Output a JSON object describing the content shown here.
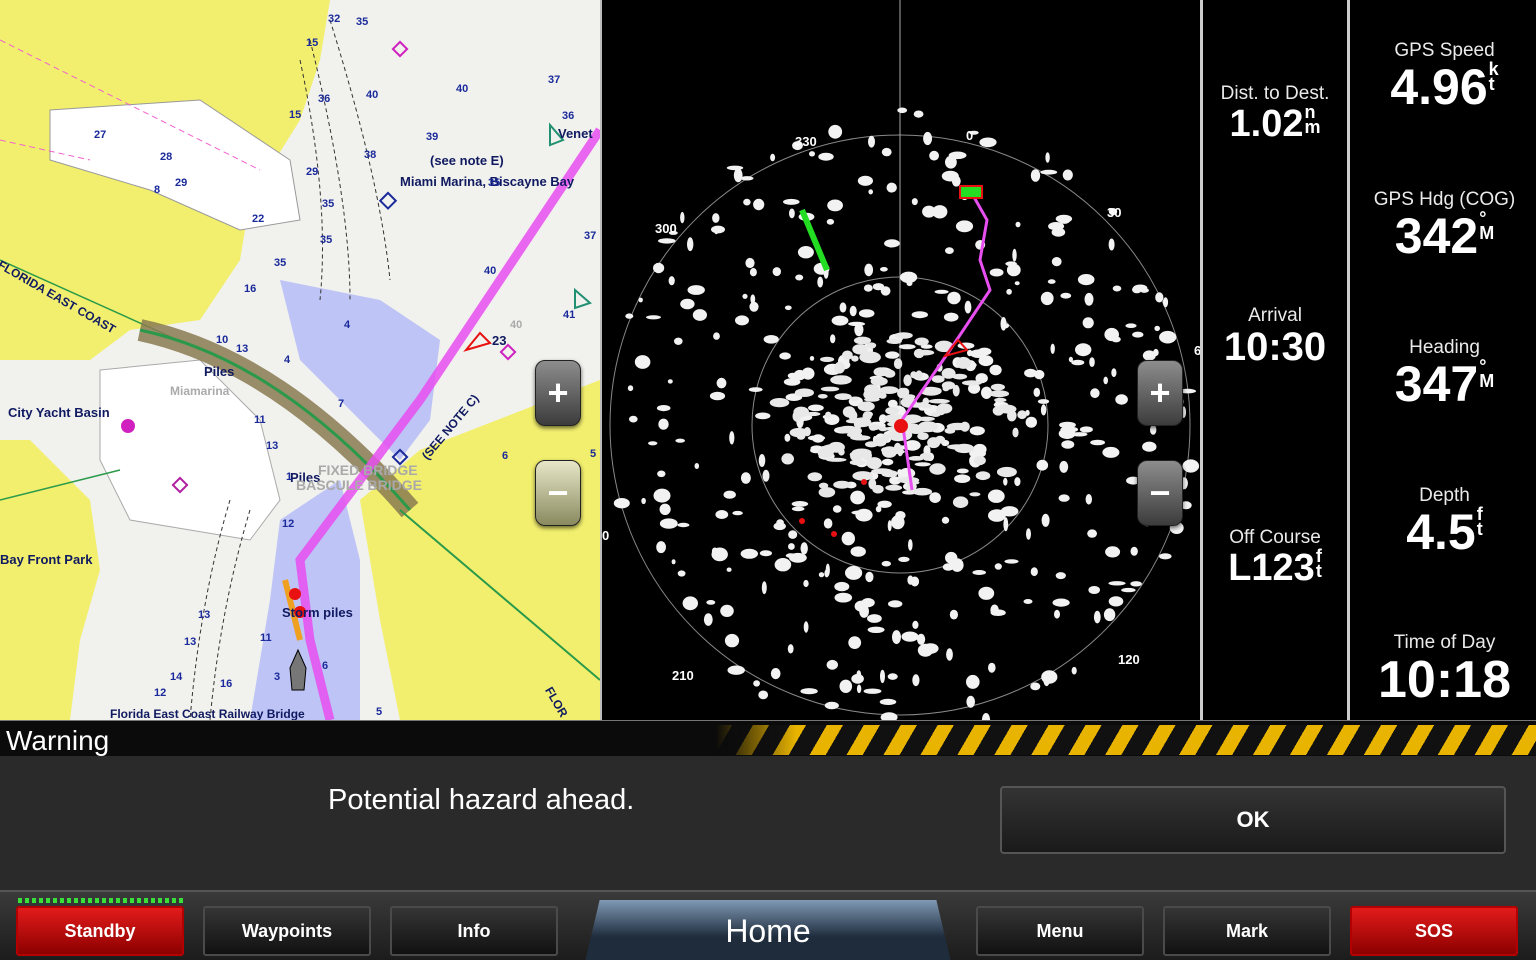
{
  "chart": {
    "labels": {
      "city_yacht_basin": "City Yacht Basin",
      "bay_front_park": "Bay Front Park",
      "miami_marina": "Miami Marina, Biscayne Bay",
      "see_note_e": "(see note E)",
      "see_note_c": "(SEE NOTE C)",
      "piles_upper": "Piles",
      "piles_lower": "Piles",
      "storm_piles": "Storm piles",
      "miamarina": "Miamarina",
      "fixed_bridge": "FIXED BRIDGE",
      "bascule_bridge": "BASCULE BRIDGE",
      "florida_east_coast": "FLORIDA EAST COAST",
      "fec_railway_bridge": "Florida East Coast Railway Bridge",
      "venet": "Venet",
      "flor": "FLOR",
      "waypoint_23": "23"
    },
    "depths": [
      "32",
      "35",
      "15",
      "36",
      "40",
      "40",
      "27",
      "28",
      "29",
      "8",
      "39",
      "38",
      "29",
      "35",
      "15",
      "22",
      "35",
      "35",
      "16",
      "35",
      "37",
      "36",
      "37",
      "40",
      "41",
      "4",
      "10",
      "7",
      "13",
      "4",
      "11",
      "13",
      "12",
      "13",
      "13",
      "6",
      "11",
      "14",
      "16",
      "12",
      "3",
      "6",
      "5",
      "5",
      "1",
      "40"
    ],
    "zoom_in": "+",
    "zoom_out": "−"
  },
  "radar": {
    "bearings": {
      "b0": "0",
      "b30": "30",
      "b330": "330",
      "b300": "300",
      "b120": "120",
      "b210": "210",
      "b270": "0",
      "b90": "6"
    },
    "zoom_in": "+",
    "zoom_out": "−"
  },
  "data_left": {
    "dist_label": "Dist. to Dest.",
    "dist_value": "1.02",
    "dist_unit_top": "n",
    "dist_unit_bot": "m",
    "arrival_label": "Arrival",
    "arrival_value": "10:30",
    "offcourse_label": "Off Course",
    "offcourse_value": "L123",
    "offcourse_unit_top": "f",
    "offcourse_unit_bot": "t"
  },
  "data_right": {
    "speed_label": "GPS Speed",
    "speed_value": "4.96",
    "speed_unit_top": "k",
    "speed_unit_bot": "t",
    "cog_label": "GPS Hdg (COG)",
    "cog_value": "342",
    "cog_unit_top": "°",
    "cog_unit_bot": "M",
    "heading_label": "Heading",
    "heading_value": "347",
    "heading_unit_top": "°",
    "heading_unit_bot": "M",
    "depth_label": "Depth",
    "depth_value": "4.5",
    "depth_unit_top": "f",
    "depth_unit_bot": "t",
    "time_label": "Time of Day",
    "time_value": "10:18"
  },
  "warning": {
    "title": "Warning",
    "message": "Potential hazard ahead.",
    "ok_label": "OK"
  },
  "bottom_bar": {
    "standby": "Standby",
    "waypoints": "Waypoints",
    "info": "Info",
    "home": "Home",
    "menu": "Menu",
    "mark": "Mark",
    "sos": "SOS"
  },
  "colors": {
    "land": "#f2ef6e",
    "water_shallow": "#b8bff5",
    "route": "#e84ff0",
    "sos": "#e31b1b",
    "hazard_stripe": "#e8b400"
  }
}
